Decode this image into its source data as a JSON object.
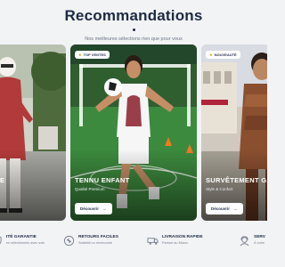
{
  "header": {
    "title": "Recommandations",
    "subtitle": "Nos meilleures sélections rien que pour vous"
  },
  "cards": [
    {
      "name": "E",
      "subtitle": "",
      "badge": ""
    },
    {
      "name": "TENNU ENFANT",
      "subtitle": "Qualité Premium",
      "badge": "TOP VENTES",
      "button": "Découvrir"
    },
    {
      "name": "SURVÊTEMENT GAR",
      "subtitle": "Style & Confort",
      "badge": "NOUVEAUTÉ",
      "button": "Découvrir"
    }
  ],
  "features": [
    {
      "title": "ITÉ GARANTIE",
      "subtitle": "es sélectionnés avec soin",
      "icon": "shield-check-icon"
    },
    {
      "title": "RETOURS FACILES",
      "subtitle": "Satisfait ou remboursé",
      "icon": "return-arrows-icon"
    },
    {
      "title": "LIVRAISON RAPIDE",
      "subtitle": "Partout au Maroc",
      "icon": "truck-icon"
    },
    {
      "title": "SERV",
      "subtitle": "À votre",
      "icon": "support-agent-icon"
    }
  ],
  "colors": {
    "navy": "#1d2a44",
    "accent_star": "#e0a21b",
    "background": "#f2f3f5"
  }
}
